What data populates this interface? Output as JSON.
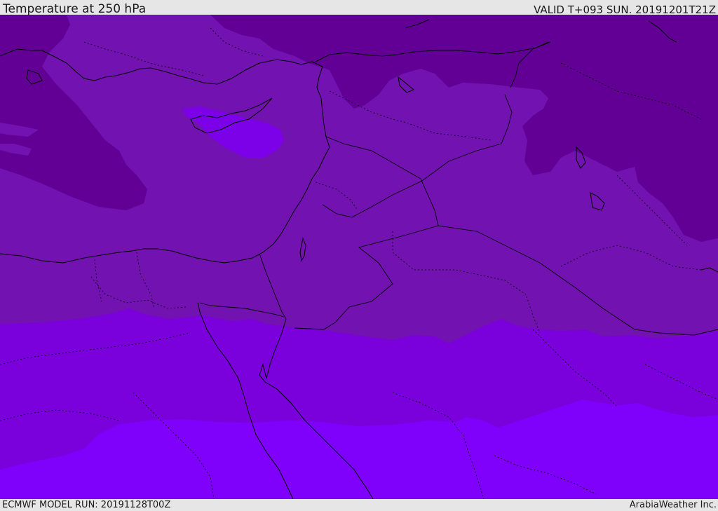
{
  "header": {
    "title": "Temperature at 250 hPa",
    "valid": "VALID T+093 SUN. 20191201T21Z"
  },
  "footer": {
    "model_run": "ECMWF MODEL RUN: 20191128T00Z",
    "credit": "ArabiaWeather Inc."
  },
  "map": {
    "field": "Temperature at 250 hPa",
    "region": "Eastern Mediterranean, Levant, Egypt, Arabian Peninsula, Iraq",
    "colors": {
      "coldest_band": "#620096",
      "cold_band": "#7212b0",
      "mid_band": "#7a00dc",
      "warm_band": "#7f00fb",
      "pocket": "#7c00e8",
      "coastline": "#000000"
    },
    "layers": [
      "temperature-shading",
      "coastlines",
      "country-borders",
      "admin-borders"
    ]
  }
}
